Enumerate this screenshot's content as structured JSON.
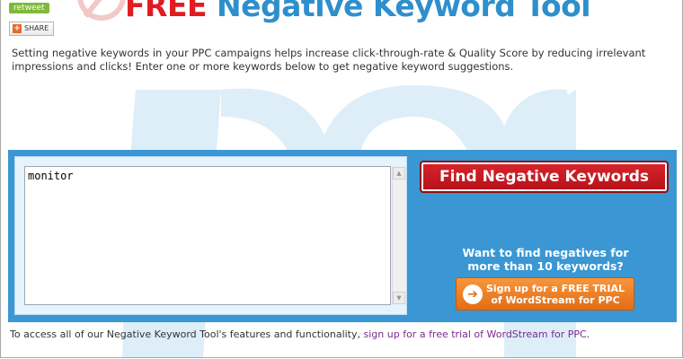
{
  "social": {
    "retweet_label": "retweet",
    "share_label": "SHARE",
    "share_icon": "plus-icon"
  },
  "header": {
    "title_free": "FREE",
    "title_rest": "Negative Keyword Tool"
  },
  "intro": {
    "text": "Setting negative keywords in your PPC campaigns helps increase click-through-rate & Quality Score by reducing irrelevant impressions and clicks! Enter one or more keywords below to get negative keyword suggestions."
  },
  "tool": {
    "keyword_value": "monitor",
    "find_button_label": "Find Negative Keywords",
    "more_prompt": "Want to find negatives for more than 10 keywords?",
    "trial_button_label": "Sign up for a FREE TRIAL of WordStream for PPC",
    "trial_icon": "arrow-right-circle-icon"
  },
  "footer": {
    "text": "To access all of our Negative Keyword Tool's features and functionality,",
    "link_label": "sign up for a free trial of WordStream for PPC",
    "end": "."
  },
  "colors": {
    "brand_red": "#e11b22",
    "brand_blue": "#2e8fcb",
    "panel_blue": "#3a97d3",
    "trial_orange": "#e36d14",
    "retweet_green": "#7fb93a"
  }
}
